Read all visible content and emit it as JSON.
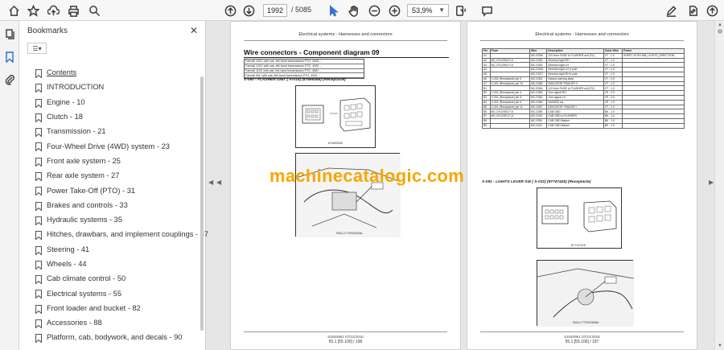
{
  "toolbar": {
    "current_page": "1992",
    "page_total": "/ 5085",
    "zoom": "53,9%"
  },
  "bookmarks": {
    "title": "Bookmarks",
    "items": [
      "Contents",
      "INTRODUCTION",
      "Engine - 10",
      "Clutch - 18",
      "Transmission - 21",
      "Four-Wheel Drive (4WD) system - 23",
      "Front axle system - 25",
      "Rear axle system - 27",
      "Power Take-Off (PTO) - 31",
      "Brakes and controls - 33",
      "Hydraulic systems - 35",
      "Hitches, drawbars, and implement couplings - 37",
      "Steering - 41",
      "Wheels - 44",
      "Cab climate control - 50",
      "Electrical systems - 55",
      "Front loader and bucket - 82",
      "Accessories - 88",
      "Platform, cab, bodywork, and decals - 90"
    ]
  },
  "left_page": {
    "header": "Electrical systems - Harnesses and connectors",
    "section_title": "Wire connectors - Component diagram 09",
    "harness_rows": [
      "Farmall 100C with cab, left-hand transmission PTO, 4WD ...",
      "Farmall 120C with cab, left-hand transmission PTO, 4WD ...",
      "Farmall 110C with cab, left-hand transmission PTO, 4WD ...",
      "Farmall 90C with cab, left-hand transmission PTO, 4WD ..."
    ],
    "caption1": "X-090 - FLASHER UNIT [ A-015] (87699386) (Receptacle)",
    "fig1_label": "87699386",
    "fig2_label": "RAIL17TR00384A",
    "footer1": "51540951 07/11/2016",
    "footer2": "55.1 [55.100] / 196"
  },
  "right_page": {
    "header": "Electrical systems - Harnesses and connectors",
    "table_headers": [
      "Pin",
      "From",
      "Wire",
      "Description",
      "Color Wire",
      "Frame"
    ],
    "table_rows": [
      [
        "A1",
        "",
        "MC-E0D6",
        "12V from FUSE to FLASHER unit (F1)",
        "VT - 1.0",
        "SHEET 42 EH-066_LIGHTS_DIRECTION"
      ],
      [
        "A2",
        "MC-CR-D393-P-A",
        "MC-D393",
        "Direction light RH",
        "VT - 1.0",
        ""
      ],
      [
        "A3",
        "MC-CR-D392-P-A",
        "MC-D392",
        "Direction light LH",
        "VT - 1.0",
        ""
      ],
      [
        "A4",
        "",
        "MC-D3G5",
        "Direction light LH tr pole",
        "VT - 1.0",
        ""
      ],
      [
        "A5",
        "",
        "MC-D3G7",
        "Direction light RH tr pole",
        "VT - 1.0",
        ""
      ],
      [
        "A6",
        "X-002 (Receptacle) pin 5",
        "MC-D361",
        "Hazard warning lamp",
        "VT - 0.5",
        ""
      ],
      [
        "A7",
        "X-401 (Receptacle) pin 10",
        "MC-D368",
        "INDICATOR TRAILER X",
        "VT - 1.0",
        ""
      ],
      [
        "B1",
        "",
        "MC-E06A",
        "12V from FUSE to FLASHER unit (F1)",
        "VT - 1.0",
        ""
      ],
      [
        "B2",
        "X-001 (Receptacle) pin 4",
        "MC-D363",
        "Turn signal RH",
        "YE - 0.5",
        ""
      ],
      [
        "B3",
        "X-001 (Receptacle) pin 5",
        "MC-D362",
        "Turn signal LH",
        "YE - 0.5",
        ""
      ],
      [
        "B4",
        "X-002 (Receptacle) pin 6",
        "MC-D366",
        "HAZARD sw",
        "YE - 1.0",
        ""
      ],
      [
        "B5",
        "X-401 (Receptacle) pin 11",
        "MC-D367",
        "INDICATOR TRAILER I",
        "VT - 1.0",
        ""
      ],
      [
        "B6",
        "MC-CR-D390-P-A",
        "MC-D390",
        "CAB GND",
        "BK - 1.0",
        ""
      ],
      [
        "B7",
        "MC-CR-D391-P-A",
        "MC-D391",
        "CAB GND to FLASHER",
        "BK - 1.0",
        ""
      ],
      [
        "B8",
        "",
        "MC-D35L",
        "CAB GND Marker",
        "BK - 1.0",
        ""
      ],
      [
        "B9",
        "",
        "MC-D311",
        "CAB GND Marker",
        "BK - 1.0",
        ""
      ]
    ],
    "caption1": "X-091 - LIGHTS LEVER SW [ S-032] (87747425) (Receptacle)",
    "fig1_label": "87747425",
    "fig2_label": "RAIL17TR00386A",
    "footer1": "51540951 07/11/2016",
    "footer2": "55.1 [55.100] / 197"
  },
  "watermark": "machinecatalogic.com"
}
